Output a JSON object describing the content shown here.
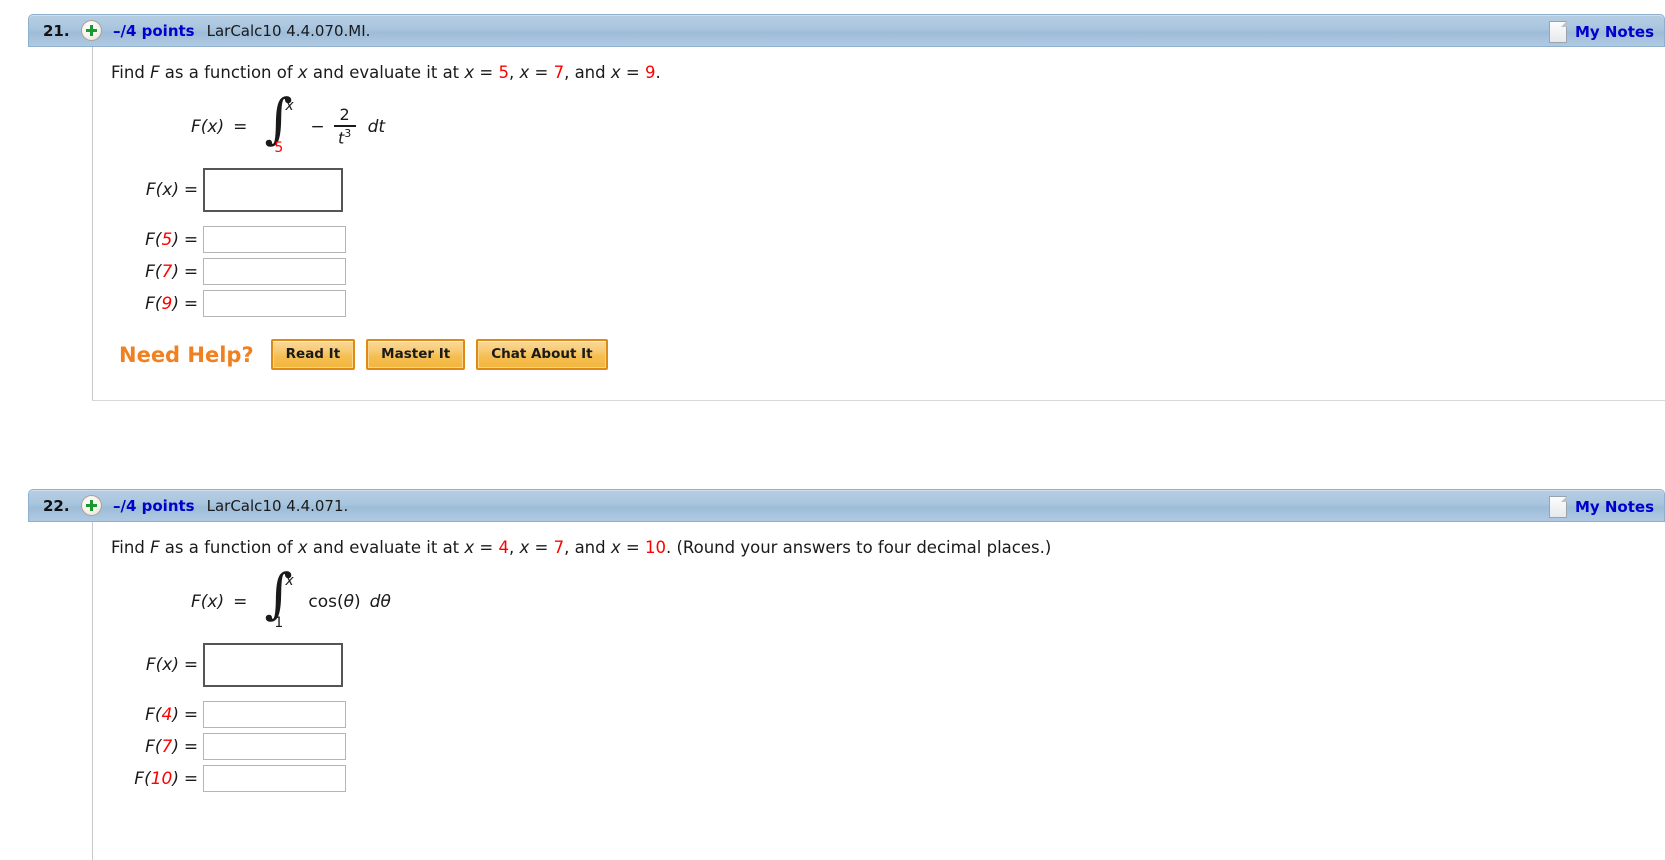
{
  "questions": [
    {
      "number": "21.",
      "points": "–/4 points",
      "tag": "LarCalc10 4.4.070.MI.",
      "notes_label": "My Notes",
      "prompt": {
        "p1": "Find ",
        "F": "F",
        "p2": " as a function of ",
        "x1": "x",
        "p3": " and evaluate it at ",
        "x2": "x",
        "eq1": " = ",
        "v1": "5",
        "sep1": ",  ",
        "x3": "x",
        "eq2": " = ",
        "v2": "7",
        "sep2": ", and ",
        "x4": "x",
        "eq3": " = ",
        "v3": "9",
        "p4": "."
      },
      "formula": {
        "lhs": "F(x)",
        "equals": "=",
        "integral_sign": "∫",
        "upper_limit": "x",
        "lower_limit": "5",
        "minus": "−",
        "numerator": "2",
        "denominator": "t",
        "denominator_exponent": "3",
        "differential": "dt"
      },
      "answers": [
        {
          "label_pre": "F(",
          "label_var": "x",
          "label_post": ")",
          "var_red": false,
          "equals": "=",
          "size": "main",
          "value": ""
        },
        {
          "label_pre": "F(",
          "label_var": "5",
          "label_post": ")",
          "var_red": true,
          "equals": "=",
          "size": "small",
          "value": ""
        },
        {
          "label_pre": "F(",
          "label_var": "7",
          "label_post": ")",
          "var_red": true,
          "equals": "=",
          "size": "small",
          "value": ""
        },
        {
          "label_pre": "F(",
          "label_var": "9",
          "label_post": ")",
          "var_red": true,
          "equals": "=",
          "size": "small",
          "value": ""
        }
      ],
      "need_help": {
        "label": "Need Help?",
        "buttons": [
          "Read It",
          "Master It",
          "Chat About It"
        ]
      }
    },
    {
      "number": "22.",
      "points": "–/4 points",
      "tag": "LarCalc10 4.4.071.",
      "notes_label": "My Notes",
      "prompt": {
        "p1": "Find ",
        "F": "F",
        "p2": " as a function of ",
        "x1": "x",
        "p3": " and evaluate it at ",
        "x2": "x",
        "eq1": " = ",
        "v1": "4",
        "sep1": ",  ",
        "x3": "x",
        "eq2": " = ",
        "v2": "7",
        "sep2": ", and ",
        "x4": "x",
        "eq3": " = ",
        "v3": "10",
        "p4": ". (Round your answers to four decimal places.)"
      },
      "formula": {
        "lhs": "F(x)",
        "equals": "=",
        "integral_sign": "∫",
        "upper_limit": "x",
        "lower_limit": "1",
        "function_name": "cos(",
        "function_arg": "θ",
        "function_close": ")",
        "differential_d": "d",
        "differential_var": "θ"
      },
      "answers": [
        {
          "label_pre": "F(",
          "label_var": "x",
          "label_post": ")",
          "var_red": false,
          "equals": "=",
          "size": "main",
          "value": ""
        },
        {
          "label_pre": "F(",
          "label_var": "4",
          "label_post": ")",
          "var_red": true,
          "equals": "=",
          "size": "small",
          "value": ""
        },
        {
          "label_pre": "F(",
          "label_var": "7",
          "label_post": ")",
          "var_red": true,
          "equals": "=",
          "size": "small",
          "value": ""
        },
        {
          "label_pre": "F(",
          "label_var": "10",
          "label_post": ")",
          "var_red": true,
          "equals": "=",
          "size": "small",
          "value": ""
        }
      ]
    }
  ],
  "colors": {
    "header_bar": "#a9c5de",
    "link_blue": "#0000cd",
    "value_red": "#ff0000",
    "need_help_orange": "#f08020",
    "button_orange": "#f5bf52"
  }
}
